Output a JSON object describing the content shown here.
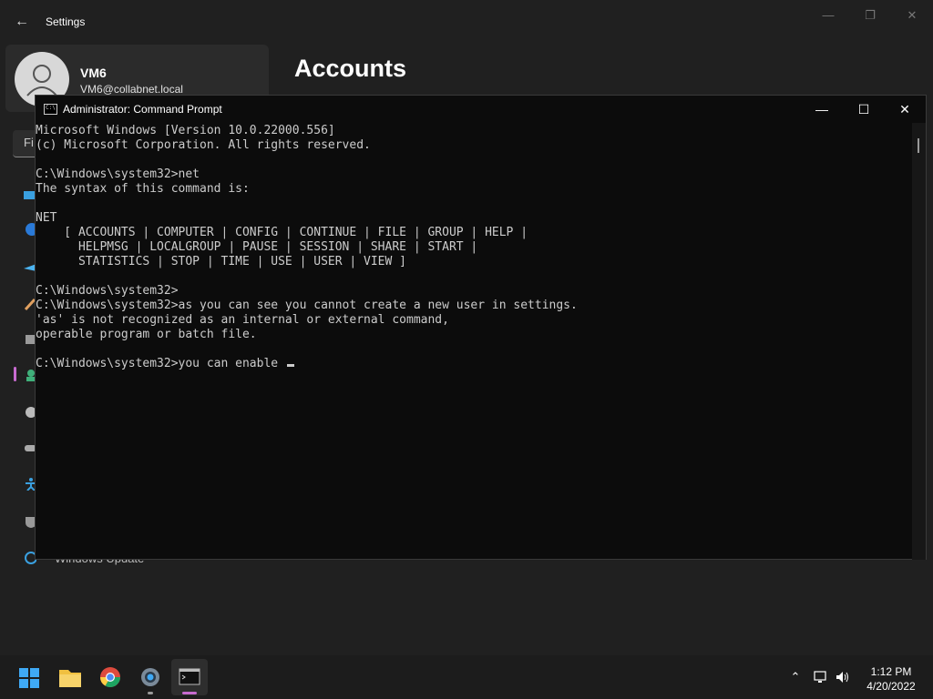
{
  "settings": {
    "back_icon": "arrow-left-icon",
    "title": "Settings",
    "profile": {
      "name": "VM6",
      "email": "VM6@collabnet.local"
    },
    "page_title": "Accounts",
    "find_placeholder": "Fi",
    "partial_nav_label": "Windows Update",
    "nav_icons": [
      "system-icon",
      "bluetooth-icon",
      "network-icon",
      "personalization-icon",
      "apps-icon",
      "accounts-icon",
      "time-language-icon",
      "gaming-icon",
      "accessibility-icon",
      "privacy-security-icon",
      "windows-update-icon"
    ],
    "accent_color": "#c86bd0"
  },
  "cmd": {
    "title": "Administrator: Command Prompt",
    "lines": [
      "Microsoft Windows [Version 10.0.22000.556]",
      "(c) Microsoft Corporation. All rights reserved.",
      "",
      "C:\\Windows\\system32>net",
      "The syntax of this command is:",
      "",
      "NET",
      "    [ ACCOUNTS | COMPUTER | CONFIG | CONTINUE | FILE | GROUP | HELP |",
      "      HELPMSG | LOCALGROUP | PAUSE | SESSION | SHARE | START |",
      "      STATISTICS | STOP | TIME | USE | USER | VIEW ]",
      "",
      "C:\\Windows\\system32>",
      "C:\\Windows\\system32>as you can see you cannot create a new user in settings.",
      "'as' is not recognized as an internal or external command,",
      "operable program or batch file.",
      "",
      "C:\\Windows\\system32>you can enable "
    ],
    "text_color": "#cccccc",
    "background": "#0c0c0c"
  },
  "taskbar": {
    "apps": [
      "start-icon",
      "file-explorer-icon",
      "chrome-icon",
      "settings-icon",
      "terminal-icon"
    ],
    "time": "1:12 PM",
    "date": "4/20/2022"
  }
}
